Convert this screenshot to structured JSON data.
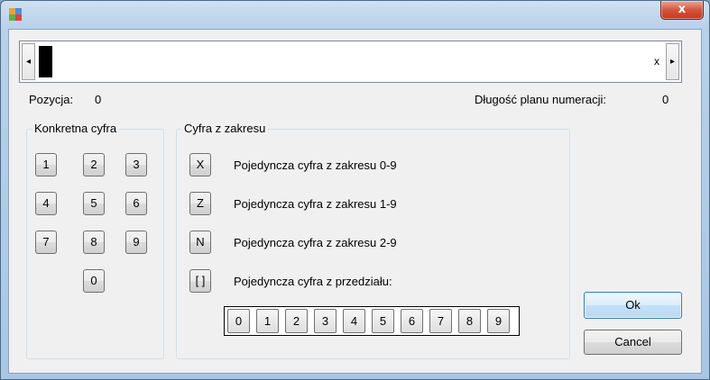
{
  "window": {
    "close_label": "x"
  },
  "plan_field": {
    "clear_label": "x",
    "left_arrow": "◂",
    "right_arrow": "▸"
  },
  "position": {
    "label": "Pozycja:",
    "value": "0"
  },
  "length": {
    "label": "Długość planu numeracji:",
    "value": "0"
  },
  "specific_digit": {
    "title": "Konkretna cyfra",
    "digits": [
      "1",
      "2",
      "3",
      "4",
      "5",
      "6",
      "7",
      "8",
      "9",
      "0"
    ]
  },
  "range_digit": {
    "title": "Cyfra z zakresu",
    "options": [
      {
        "key": "X",
        "text": "Pojedyncza cyfra z zakresu 0-9"
      },
      {
        "key": "Z",
        "text": "Pojedyncza cyfra z zakresu 1-9"
      },
      {
        "key": "N",
        "text": "Pojedyncza cyfra z zakresu 2-9"
      },
      {
        "key": "[ ]",
        "text": "Pojedyncza cyfra z przedziału:"
      }
    ],
    "range_digits": [
      "0",
      "1",
      "2",
      "3",
      "4",
      "5",
      "6",
      "7",
      "8",
      "9"
    ]
  },
  "actions": {
    "ok": "Ok",
    "cancel": "Cancel"
  }
}
